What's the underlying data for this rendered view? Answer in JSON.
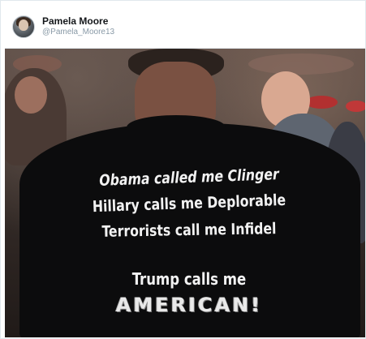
{
  "tweet": {
    "display_name": "Pamela Moore",
    "handle": "@Pamela_Moore13"
  },
  "media": {
    "shirt_text": {
      "line1": "Obama called me Clinger",
      "line2": "Hillary calls me Deplorable",
      "line3": "Terrorists call me Infidel",
      "line4": "Trump calls me",
      "line5": "AMERICAN!"
    }
  },
  "colors": {
    "name": "#14171a",
    "handle": "#8899a6",
    "border": "#e1e8ed",
    "shirt": "#0c0c0d",
    "shirt_text": "#f2f2f2"
  }
}
